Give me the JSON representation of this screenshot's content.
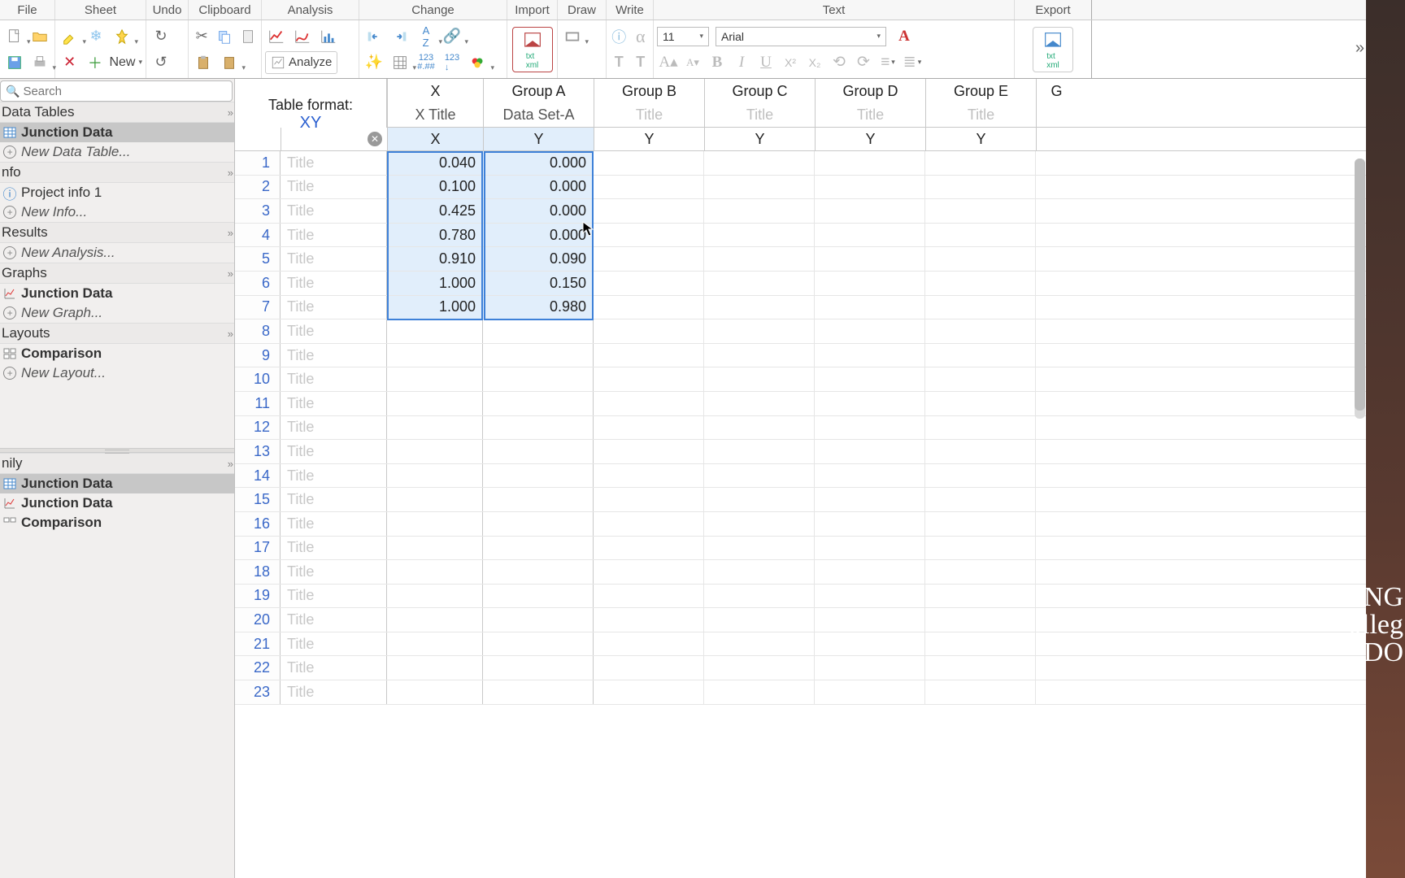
{
  "ribbon_groups": {
    "file": "File",
    "sheet": "Sheet",
    "undo": "Undo",
    "clipboard": "Clipboard",
    "analysis": "Analysis",
    "change": "Change",
    "import": "Import",
    "draw": "Draw",
    "write": "Write",
    "text": "Text",
    "export": "Export"
  },
  "toolbar": {
    "new_label": "New",
    "analyze_label": "Analyze",
    "font_size": "11",
    "font_name": "Arial",
    "xml_label": "txt\nxml"
  },
  "search_placeholder": "Search",
  "nav": {
    "data_tables": "Data Tables",
    "junction_data": "Junction Data",
    "new_data_table": "New Data Table...",
    "info": "nfo",
    "project_info": "Project info 1",
    "new_info": "New Info...",
    "results": "Results",
    "new_analysis": "New Analysis...",
    "graphs": "Graphs",
    "new_graph": "New Graph...",
    "layouts": "Layouts",
    "comparison": "Comparison",
    "new_layout": "New Layout...",
    "family_header": "nily"
  },
  "table": {
    "format_label": "Table format:",
    "format_value": "XY",
    "groups": [
      "X",
      "Group A",
      "Group B",
      "Group C",
      "Group D",
      "Group E",
      "G"
    ],
    "subtitles": [
      "X Title",
      "Data Set-A",
      "Title",
      "Title",
      "Title",
      "Title",
      ""
    ],
    "coltypes": [
      "X",
      "Y",
      "Y",
      "Y",
      "Y",
      "Y",
      ""
    ],
    "row_title_placeholder": "Title",
    "rows_visible": 23,
    "chart_data": {
      "type": "table",
      "columns": [
        "X",
        "Y"
      ],
      "data": [
        [
          0.04,
          0.0
        ],
        [
          0.1,
          0.0
        ],
        [
          0.425,
          0.0
        ],
        [
          0.78,
          0.0
        ],
        [
          0.91,
          0.09
        ],
        [
          1.0,
          0.15
        ],
        [
          1.0,
          0.98
        ]
      ]
    }
  }
}
